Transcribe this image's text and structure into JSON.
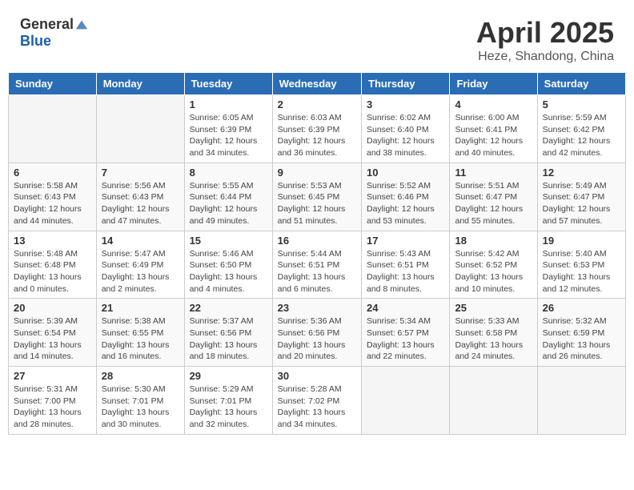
{
  "header": {
    "logo_general": "General",
    "logo_blue": "Blue",
    "month": "April 2025",
    "location": "Heze, Shandong, China"
  },
  "weekdays": [
    "Sunday",
    "Monday",
    "Tuesday",
    "Wednesday",
    "Thursday",
    "Friday",
    "Saturday"
  ],
  "weeks": [
    {
      "days": [
        {
          "num": "",
          "empty": true
        },
        {
          "num": "",
          "empty": true
        },
        {
          "num": "1",
          "sunrise": "Sunrise: 6:05 AM",
          "sunset": "Sunset: 6:39 PM",
          "daylight": "Daylight: 12 hours and 34 minutes."
        },
        {
          "num": "2",
          "sunrise": "Sunrise: 6:03 AM",
          "sunset": "Sunset: 6:39 PM",
          "daylight": "Daylight: 12 hours and 36 minutes."
        },
        {
          "num": "3",
          "sunrise": "Sunrise: 6:02 AM",
          "sunset": "Sunset: 6:40 PM",
          "daylight": "Daylight: 12 hours and 38 minutes."
        },
        {
          "num": "4",
          "sunrise": "Sunrise: 6:00 AM",
          "sunset": "Sunset: 6:41 PM",
          "daylight": "Daylight: 12 hours and 40 minutes."
        },
        {
          "num": "5",
          "sunrise": "Sunrise: 5:59 AM",
          "sunset": "Sunset: 6:42 PM",
          "daylight": "Daylight: 12 hours and 42 minutes."
        }
      ]
    },
    {
      "days": [
        {
          "num": "6",
          "sunrise": "Sunrise: 5:58 AM",
          "sunset": "Sunset: 6:43 PM",
          "daylight": "Daylight: 12 hours and 44 minutes."
        },
        {
          "num": "7",
          "sunrise": "Sunrise: 5:56 AM",
          "sunset": "Sunset: 6:43 PM",
          "daylight": "Daylight: 12 hours and 47 minutes."
        },
        {
          "num": "8",
          "sunrise": "Sunrise: 5:55 AM",
          "sunset": "Sunset: 6:44 PM",
          "daylight": "Daylight: 12 hours and 49 minutes."
        },
        {
          "num": "9",
          "sunrise": "Sunrise: 5:53 AM",
          "sunset": "Sunset: 6:45 PM",
          "daylight": "Daylight: 12 hours and 51 minutes."
        },
        {
          "num": "10",
          "sunrise": "Sunrise: 5:52 AM",
          "sunset": "Sunset: 6:46 PM",
          "daylight": "Daylight: 12 hours and 53 minutes."
        },
        {
          "num": "11",
          "sunrise": "Sunrise: 5:51 AM",
          "sunset": "Sunset: 6:47 PM",
          "daylight": "Daylight: 12 hours and 55 minutes."
        },
        {
          "num": "12",
          "sunrise": "Sunrise: 5:49 AM",
          "sunset": "Sunset: 6:47 PM",
          "daylight": "Daylight: 12 hours and 57 minutes."
        }
      ]
    },
    {
      "days": [
        {
          "num": "13",
          "sunrise": "Sunrise: 5:48 AM",
          "sunset": "Sunset: 6:48 PM",
          "daylight": "Daylight: 13 hours and 0 minutes."
        },
        {
          "num": "14",
          "sunrise": "Sunrise: 5:47 AM",
          "sunset": "Sunset: 6:49 PM",
          "daylight": "Daylight: 13 hours and 2 minutes."
        },
        {
          "num": "15",
          "sunrise": "Sunrise: 5:46 AM",
          "sunset": "Sunset: 6:50 PM",
          "daylight": "Daylight: 13 hours and 4 minutes."
        },
        {
          "num": "16",
          "sunrise": "Sunrise: 5:44 AM",
          "sunset": "Sunset: 6:51 PM",
          "daylight": "Daylight: 13 hours and 6 minutes."
        },
        {
          "num": "17",
          "sunrise": "Sunrise: 5:43 AM",
          "sunset": "Sunset: 6:51 PM",
          "daylight": "Daylight: 13 hours and 8 minutes."
        },
        {
          "num": "18",
          "sunrise": "Sunrise: 5:42 AM",
          "sunset": "Sunset: 6:52 PM",
          "daylight": "Daylight: 13 hours and 10 minutes."
        },
        {
          "num": "19",
          "sunrise": "Sunrise: 5:40 AM",
          "sunset": "Sunset: 6:53 PM",
          "daylight": "Daylight: 13 hours and 12 minutes."
        }
      ]
    },
    {
      "days": [
        {
          "num": "20",
          "sunrise": "Sunrise: 5:39 AM",
          "sunset": "Sunset: 6:54 PM",
          "daylight": "Daylight: 13 hours and 14 minutes."
        },
        {
          "num": "21",
          "sunrise": "Sunrise: 5:38 AM",
          "sunset": "Sunset: 6:55 PM",
          "daylight": "Daylight: 13 hours and 16 minutes."
        },
        {
          "num": "22",
          "sunrise": "Sunrise: 5:37 AM",
          "sunset": "Sunset: 6:56 PM",
          "daylight": "Daylight: 13 hours and 18 minutes."
        },
        {
          "num": "23",
          "sunrise": "Sunrise: 5:36 AM",
          "sunset": "Sunset: 6:56 PM",
          "daylight": "Daylight: 13 hours and 20 minutes."
        },
        {
          "num": "24",
          "sunrise": "Sunrise: 5:34 AM",
          "sunset": "Sunset: 6:57 PM",
          "daylight": "Daylight: 13 hours and 22 minutes."
        },
        {
          "num": "25",
          "sunrise": "Sunrise: 5:33 AM",
          "sunset": "Sunset: 6:58 PM",
          "daylight": "Daylight: 13 hours and 24 minutes."
        },
        {
          "num": "26",
          "sunrise": "Sunrise: 5:32 AM",
          "sunset": "Sunset: 6:59 PM",
          "daylight": "Daylight: 13 hours and 26 minutes."
        }
      ]
    },
    {
      "days": [
        {
          "num": "27",
          "sunrise": "Sunrise: 5:31 AM",
          "sunset": "Sunset: 7:00 PM",
          "daylight": "Daylight: 13 hours and 28 minutes."
        },
        {
          "num": "28",
          "sunrise": "Sunrise: 5:30 AM",
          "sunset": "Sunset: 7:01 PM",
          "daylight": "Daylight: 13 hours and 30 minutes."
        },
        {
          "num": "29",
          "sunrise": "Sunrise: 5:29 AM",
          "sunset": "Sunset: 7:01 PM",
          "daylight": "Daylight: 13 hours and 32 minutes."
        },
        {
          "num": "30",
          "sunrise": "Sunrise: 5:28 AM",
          "sunset": "Sunset: 7:02 PM",
          "daylight": "Daylight: 13 hours and 34 minutes."
        },
        {
          "num": "",
          "empty": true
        },
        {
          "num": "",
          "empty": true
        },
        {
          "num": "",
          "empty": true
        }
      ]
    }
  ]
}
